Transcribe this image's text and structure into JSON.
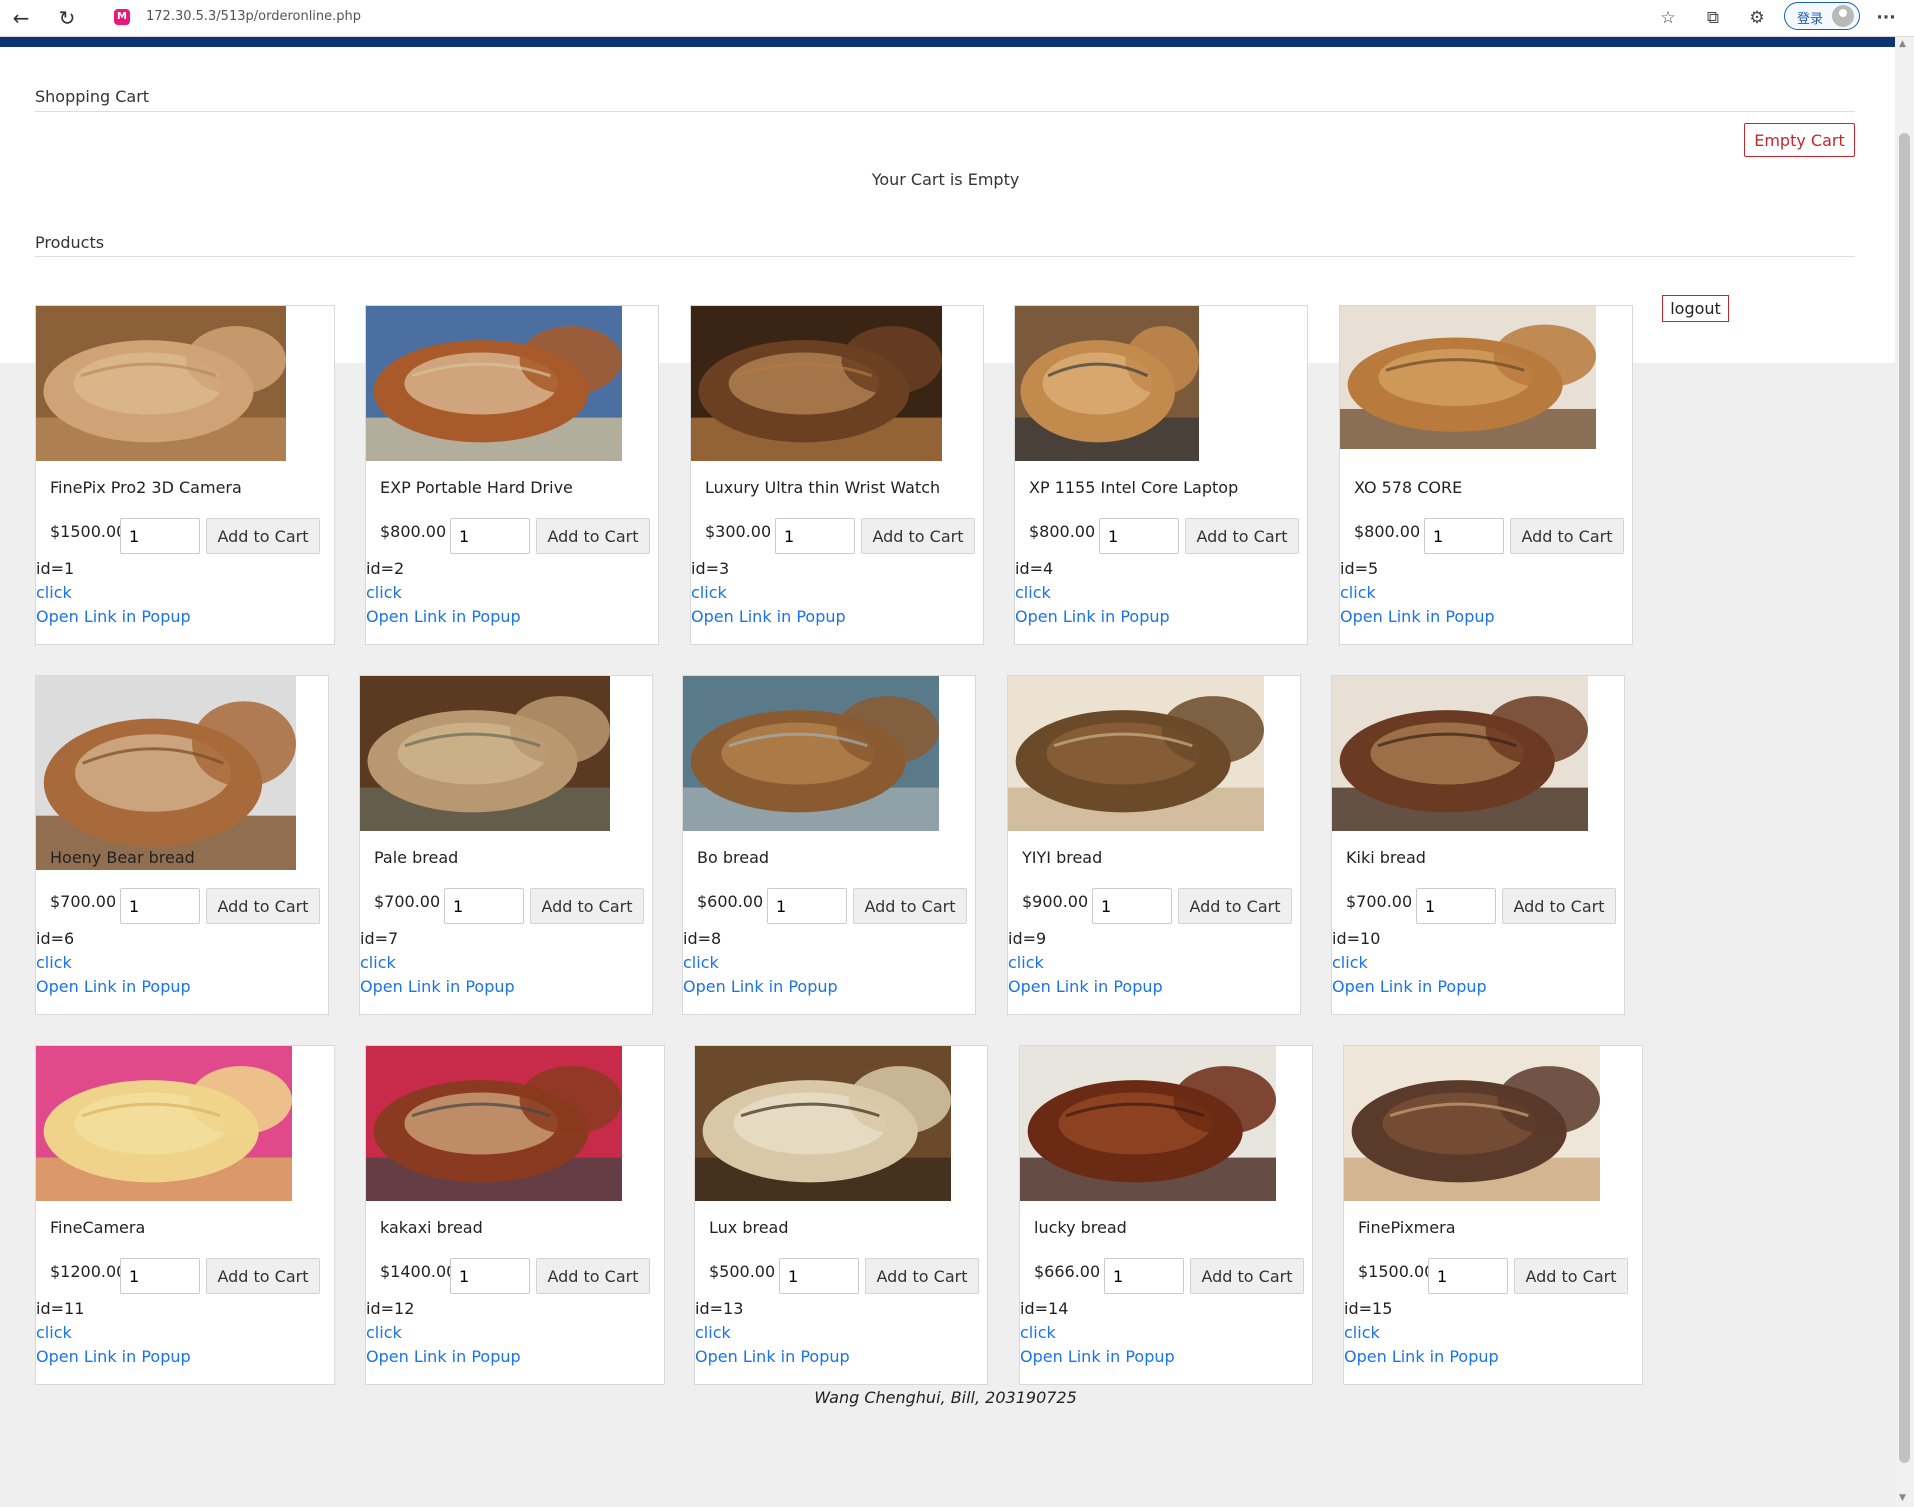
{
  "browser": {
    "url": "172.30.5.3/513p/orderonline.php",
    "site_icon_glyph": "M",
    "login_label": "登录",
    "more_label": "···"
  },
  "cart": {
    "title": "Shopping Cart",
    "empty_button": "Empty Cart",
    "empty_message": "Your Cart is Empty"
  },
  "products_title": "Products",
  "logout_label": "logout",
  "qty_default": "1",
  "add_label": "Add to Cart",
  "click_label": "click",
  "popup_label": "Open Link in Popup",
  "products": [
    {
      "name": "FinePix Pro2 3D Camera",
      "price": "$1500.00",
      "id": "id=1"
    },
    {
      "name": "EXP Portable Hard Drive",
      "price": "$800.00",
      "id": "id=2"
    },
    {
      "name": "Luxury Ultra thin Wrist Watch",
      "price": "$300.00",
      "id": "id=3"
    },
    {
      "name": "XP 1155 Intel Core Laptop",
      "price": "$800.00",
      "id": "id=4"
    },
    {
      "name": "XO 578 CORE",
      "price": "$800.00",
      "id": "id=5"
    },
    {
      "name": "Hoeny Bear bread",
      "price": "$700.00",
      "id": "id=6"
    },
    {
      "name": "Pale bread",
      "price": "$700.00",
      "id": "id=7"
    },
    {
      "name": "Bo bread",
      "price": "$600.00",
      "id": "id=8"
    },
    {
      "name": "YIYI bread",
      "price": "$900.00",
      "id": "id=9"
    },
    {
      "name": "Kiki bread",
      "price": "$700.00",
      "id": "id=10"
    },
    {
      "name": "FineCamera",
      "price": "$1200.00",
      "id": "id=11"
    },
    {
      "name": "kakaxi bread",
      "price": "$1400.00",
      "id": "id=12"
    },
    {
      "name": "Lux bread",
      "price": "$500.00",
      "id": "id=13"
    },
    {
      "name": "lucky bread",
      "price": "$666.00",
      "id": "id=14"
    },
    {
      "name": "FinePixmera",
      "price": "$1500.00",
      "id": "id=15"
    }
  ],
  "footer": "Wang Chenghui, Bill, 203190725",
  "colors": {
    "top_bar": "#0e3472",
    "danger": "#c0282d",
    "link": "#1a73e8"
  }
}
